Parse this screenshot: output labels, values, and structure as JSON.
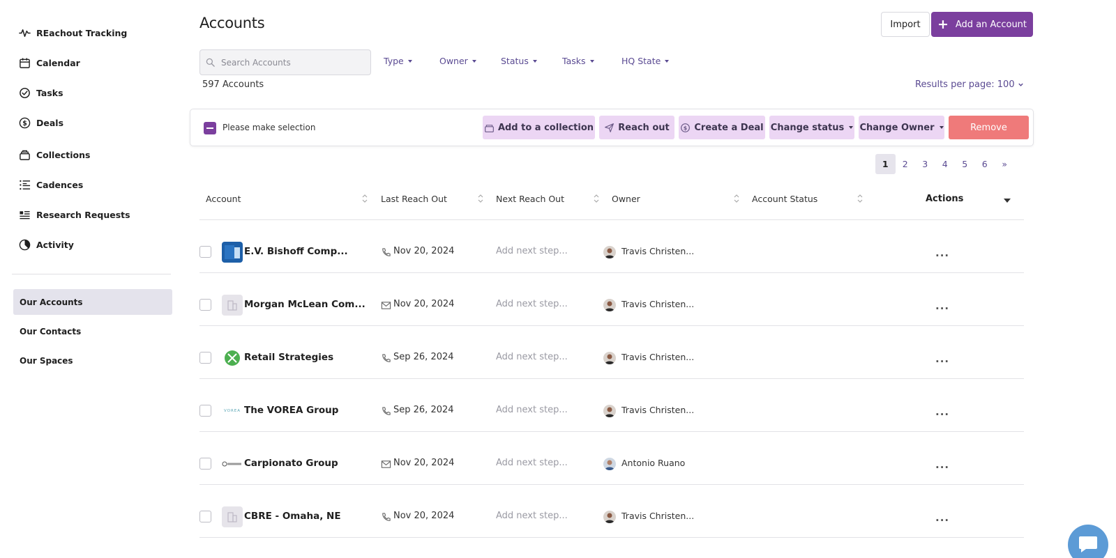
{
  "sidebar": {
    "nav_items": [
      {
        "label": "REachout Tracking",
        "icon": "activity-icon"
      },
      {
        "label": "Calendar",
        "icon": "calendar-icon"
      },
      {
        "label": "Tasks",
        "icon": "check-circle-icon"
      },
      {
        "label": "Deals",
        "icon": "dollar-circle-icon"
      },
      {
        "label": "Collections",
        "icon": "collection-icon"
      },
      {
        "label": "Cadences",
        "icon": "list-ordered-icon"
      },
      {
        "label": "Research Requests",
        "icon": "research-icon"
      },
      {
        "label": "Activity",
        "icon": "pie-icon"
      }
    ],
    "sub_items": [
      {
        "label": "Our Accounts",
        "active": true
      },
      {
        "label": "Our Contacts",
        "active": false
      },
      {
        "label": "Our Spaces",
        "active": false
      }
    ]
  },
  "header": {
    "title": "Accounts",
    "import_label": "Import",
    "add_label": "Add an Account"
  },
  "search": {
    "placeholder": "Search Accounts"
  },
  "filters": [
    "Type",
    "Owner",
    "Status",
    "Tasks",
    "HQ State"
  ],
  "summary": {
    "count_text": "597 Accounts",
    "results_per_page": "Results per page: 100"
  },
  "bulk_actions": {
    "selection_label": "Please make selection",
    "add_collection": "Add to a collection",
    "reach_out": "Reach out",
    "create_deal": "Create a Deal",
    "change_status": "Change status",
    "change_owner": "Change Owner",
    "remove": "Remove"
  },
  "pagination": {
    "pages": [
      "1",
      "2",
      "3",
      "4",
      "5",
      "6"
    ],
    "next": "»",
    "current": "1"
  },
  "table": {
    "columns": {
      "account": "Account",
      "last_reach_out": "Last Reach Out",
      "next_reach_out": "Next Reach Out",
      "owner": "Owner",
      "account_status": "Account Status",
      "actions": "Actions"
    },
    "rows": [
      {
        "account": "E.V. Bishoff Comp...",
        "logo": "blue",
        "reach_type": "phone",
        "last_reach_out": "Nov 20, 2024",
        "next_reach_out": "Add next step...",
        "owner": "Travis Christen...",
        "status": "",
        "actions": "..."
      },
      {
        "account": "Morgan McLean Com...",
        "logo": "placeholder",
        "reach_type": "email",
        "last_reach_out": "Nov 20, 2024",
        "next_reach_out": "Add next step...",
        "owner": "Travis Christen...",
        "status": "",
        "actions": "..."
      },
      {
        "account": "Retail Strategies",
        "logo": "green",
        "reach_type": "phone",
        "last_reach_out": "Sep 26, 2024",
        "next_reach_out": "Add next step...",
        "owner": "Travis Christen...",
        "status": "",
        "actions": "..."
      },
      {
        "account": "The VOREA Group",
        "logo": "text",
        "logo_text": "VOREA",
        "reach_type": "phone",
        "last_reach_out": "Sep 26, 2024",
        "next_reach_out": "Add next step...",
        "owner": "Travis Christen...",
        "status": "",
        "actions": "..."
      },
      {
        "account": "Carpionato Group",
        "logo": "gray",
        "reach_type": "email",
        "last_reach_out": "Nov 20, 2024",
        "next_reach_out": "Add next step...",
        "owner": "Antonio Ruano",
        "status": "",
        "actions": "..."
      },
      {
        "account": "CBRE - Omaha, NE",
        "logo": "placeholder",
        "reach_type": "phone",
        "last_reach_out": "Nov 20, 2024",
        "next_reach_out": "Add next step...",
        "owner": "Travis Christen...",
        "status": "",
        "actions": "..."
      }
    ]
  },
  "colors": {
    "brand_purple": "#7b3f9e",
    "link_purple": "#5a4a92",
    "bulk_button_bg": "#ecd6f4",
    "remove_red": "#ef7a7a",
    "active_sidebar_bg": "#e4e3ec",
    "chat_blue": "#5c9bd6"
  }
}
